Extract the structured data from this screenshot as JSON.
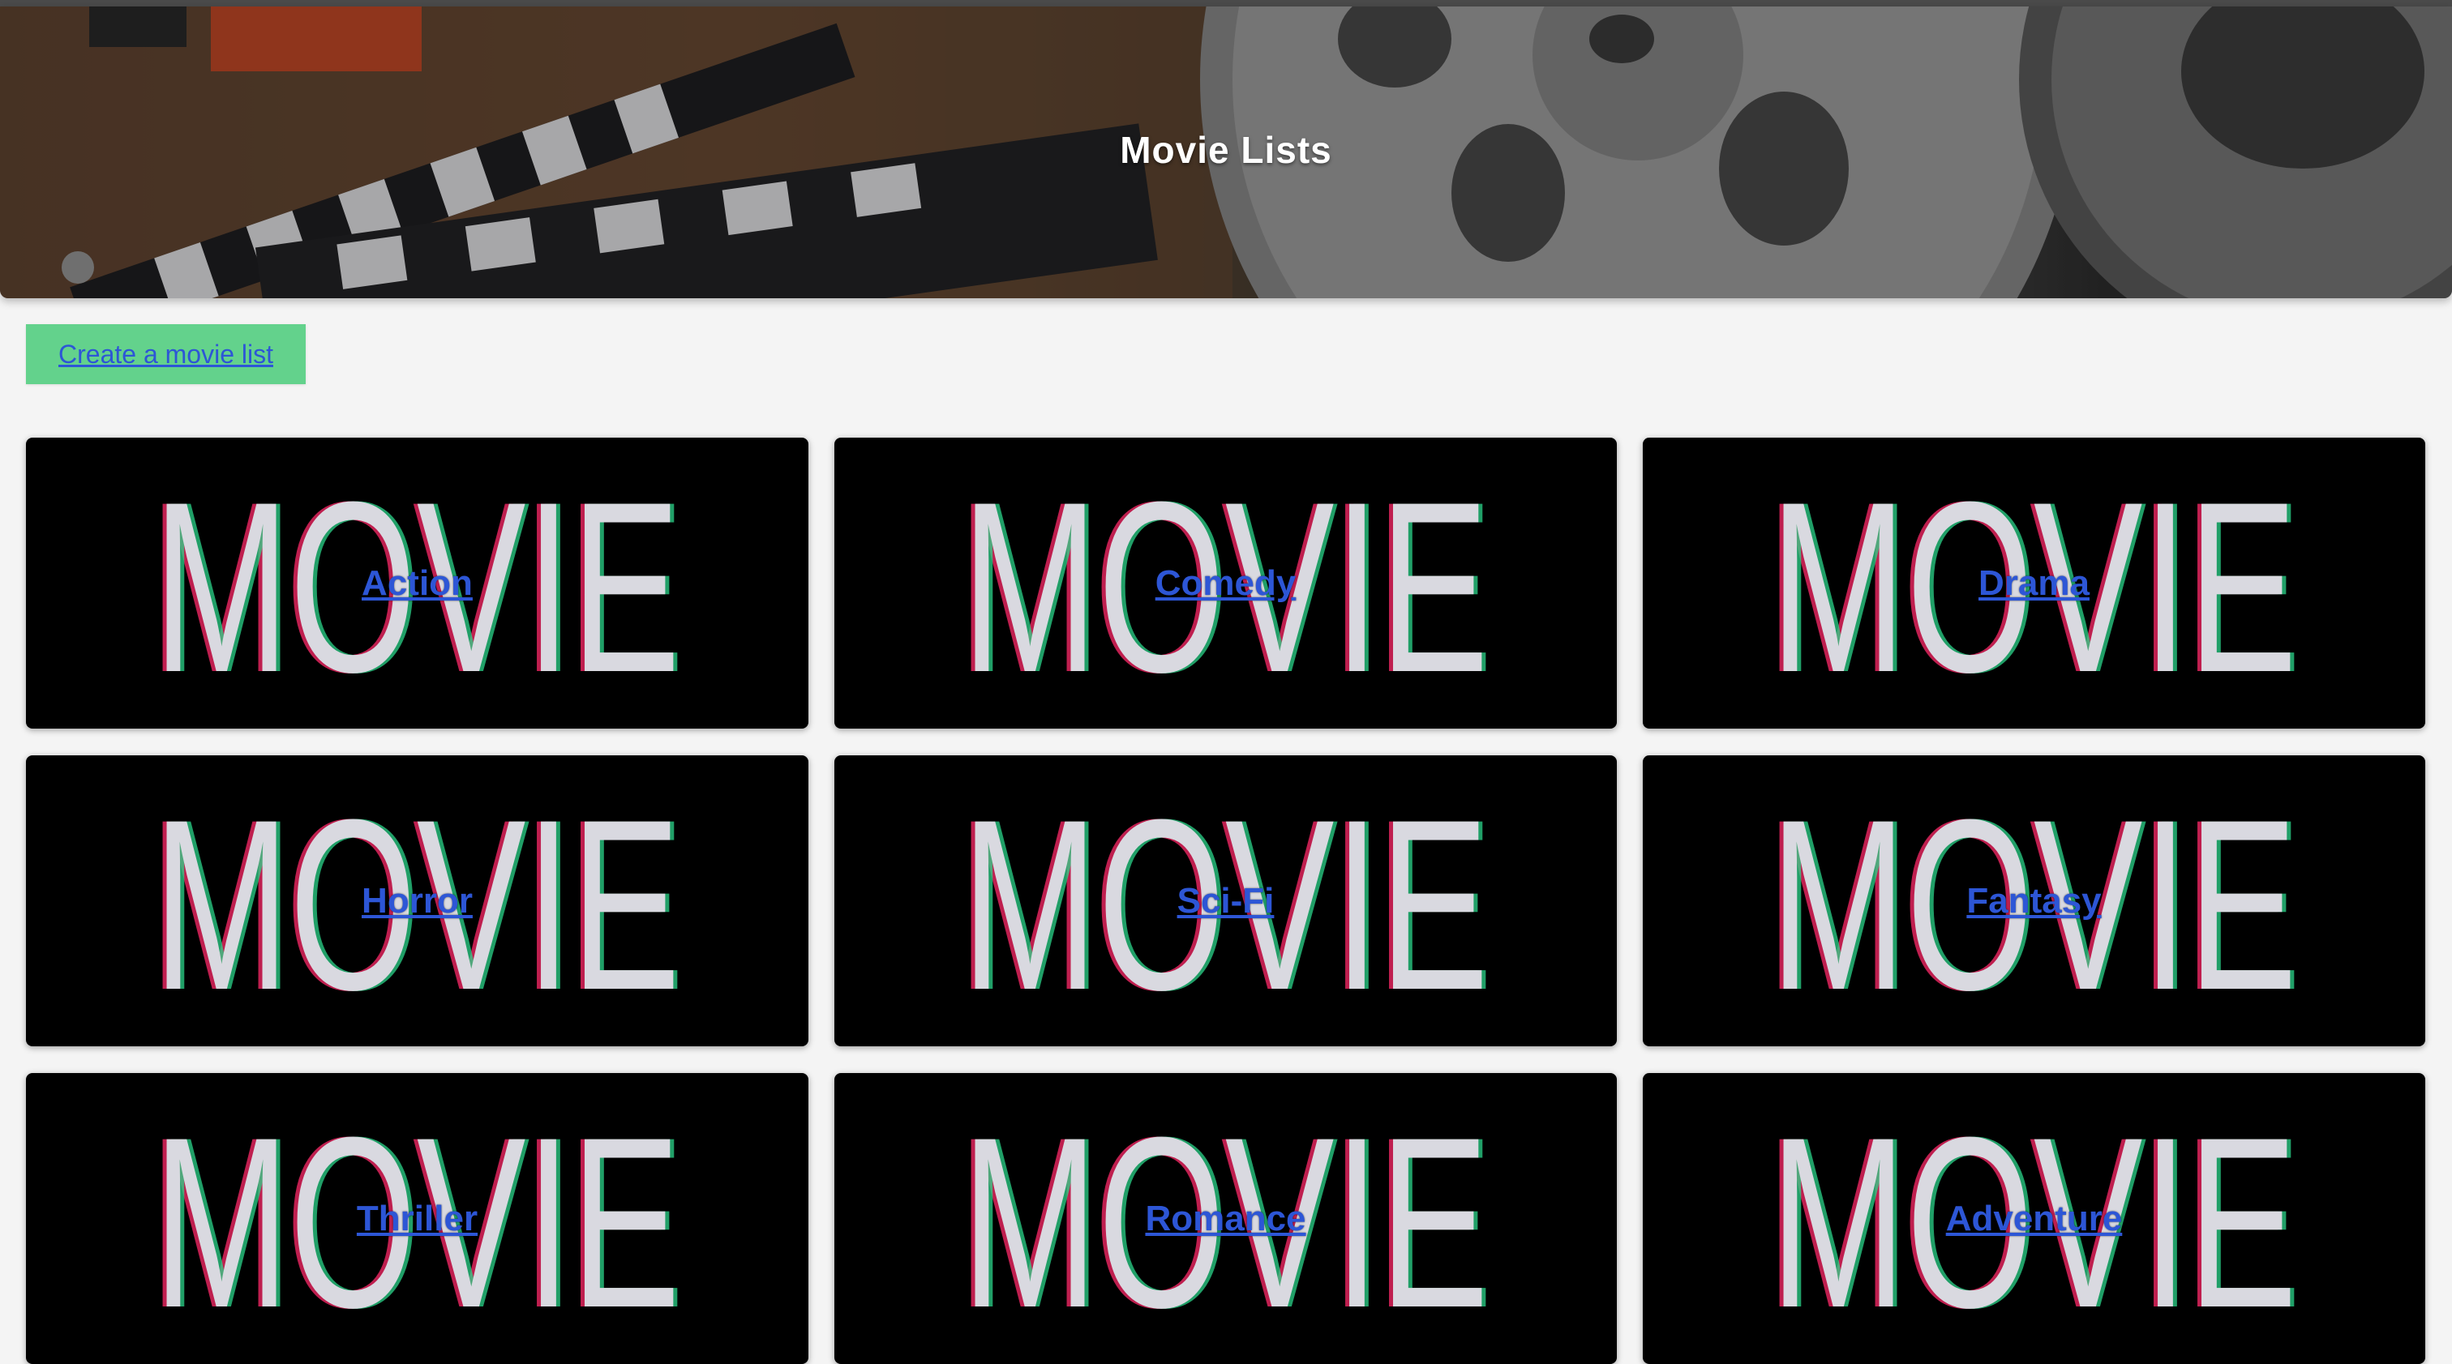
{
  "header": {
    "title": "Movie Lists"
  },
  "actions": {
    "create_label": "Create a movie list"
  },
  "lists": [
    {
      "label": "Action"
    },
    {
      "label": "Comedy"
    },
    {
      "label": "Drama"
    },
    {
      "label": "Horror"
    },
    {
      "label": "Sci-Fi"
    },
    {
      "label": "Fantasy"
    },
    {
      "label": "Thriller"
    },
    {
      "label": "Romance"
    },
    {
      "label": "Adventure"
    }
  ],
  "card_art_text": "MOVIE",
  "colors": {
    "background": "#f4f4f4",
    "button_green": "#63d28c",
    "link_blue": "#2d56d6",
    "card_black": "#000000",
    "hero_title": "#ffffff"
  }
}
